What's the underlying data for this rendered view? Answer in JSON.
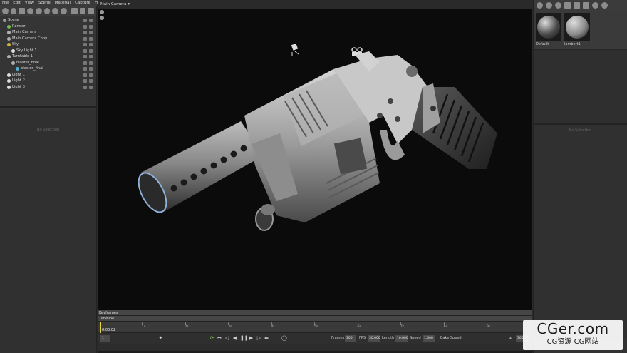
{
  "menu": [
    "File",
    "Edit",
    "View",
    "Scene",
    "Material",
    "Capture",
    "Help"
  ],
  "tree": [
    {
      "label": "Scene",
      "indent": 0,
      "icon": "scene-icon",
      "color": "#9aa0a6"
    },
    {
      "label": "Render",
      "indent": 1,
      "icon": "render-icon",
      "color": "#6fbf4a"
    },
    {
      "label": "Main Camera",
      "indent": 1,
      "icon": "camera-icon",
      "color": "#b0b0b0"
    },
    {
      "label": "Main Camera Copy",
      "indent": 1,
      "icon": "camera-icon",
      "color": "#b0b0b0"
    },
    {
      "label": "Sky",
      "indent": 1,
      "icon": "sky-icon",
      "color": "#d0b040"
    },
    {
      "label": "Sky Light 1",
      "indent": 2,
      "icon": "light-icon",
      "color": "#e0e0e0"
    },
    {
      "label": "Turntable 1",
      "indent": 1,
      "icon": "turntable-icon",
      "color": "#b0b0b0"
    },
    {
      "label": "blaster_final",
      "indent": 2,
      "icon": "mesh-icon",
      "color": "#b0b0b0"
    },
    {
      "label": "blaster_final",
      "indent": 3,
      "icon": "mesh-icon",
      "color": "#4fb0d0"
    },
    {
      "label": "Light 1",
      "indent": 1,
      "icon": "light-icon",
      "color": "#e0e0e0"
    },
    {
      "label": "Light 2",
      "indent": 1,
      "icon": "light-icon",
      "color": "#e0e0e0"
    },
    {
      "label": "Light 3",
      "indent": 1,
      "icon": "light-icon",
      "color": "#e0e0e0"
    }
  ],
  "left_props_empty": "No Selection",
  "viewport": {
    "camera_label": "Main Camera ▾"
  },
  "materials": [
    {
      "name": "Default",
      "color": "#4a4a4a"
    },
    {
      "name": "lambert1",
      "color": "#8a8a8a"
    }
  ],
  "right_props_empty": "No Selection",
  "timeline": {
    "keyframes_label": "Keyframes",
    "timeline_label": "Timeline",
    "timecode": "0:00.02",
    "current_frame": "1",
    "ticks": [
      "1s",
      "2s",
      "3s",
      "4s",
      "5s",
      "6s",
      "7s",
      "8s",
      "9s"
    ],
    "frames_label": "Frames",
    "frames_value": "300",
    "fps_label": "FPS",
    "fps_value": "30.000",
    "length_label": "Length",
    "length_value": "10.000",
    "speed_label": "Speed",
    "speed_value": "1.000",
    "bake_label": "Bake Speed",
    "end_value": "300"
  },
  "watermark": {
    "main": "CGer.com",
    "sub": "CG资源 CG网站"
  }
}
